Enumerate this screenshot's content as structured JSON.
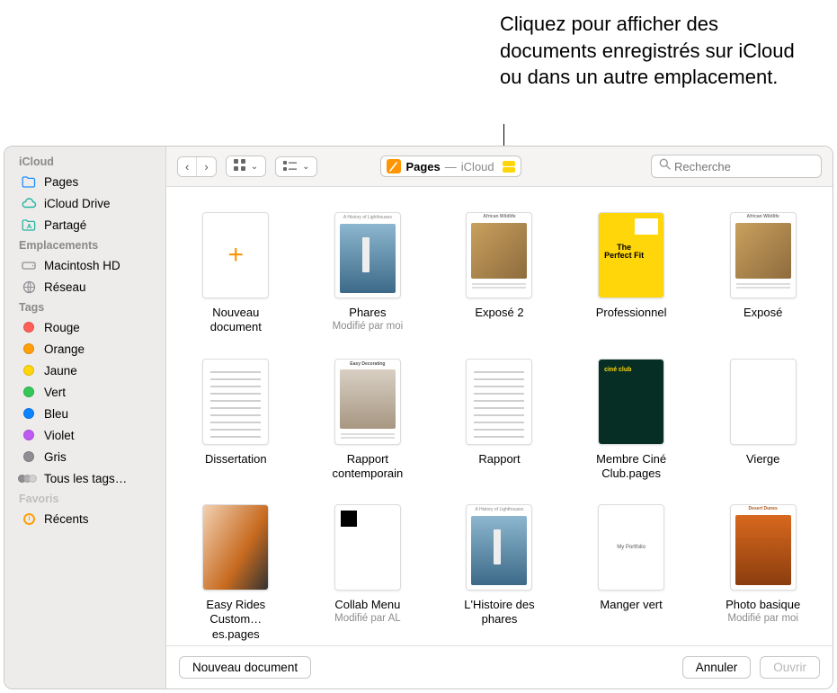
{
  "callout": "Cliquez pour afficher des documents enregistrés sur iCloud ou dans un autre emplacement.",
  "sidebar": {
    "sections": {
      "icloud": {
        "header": "iCloud",
        "items": [
          {
            "label": "Pages"
          },
          {
            "label": "iCloud Drive"
          },
          {
            "label": "Partagé"
          }
        ]
      },
      "emplacements": {
        "header": "Emplacements",
        "items": [
          {
            "label": "Macintosh HD"
          },
          {
            "label": "Réseau"
          }
        ]
      },
      "tags": {
        "header": "Tags",
        "items": [
          {
            "label": "Rouge"
          },
          {
            "label": "Orange"
          },
          {
            "label": "Jaune"
          },
          {
            "label": "Vert"
          },
          {
            "label": "Bleu"
          },
          {
            "label": "Violet"
          },
          {
            "label": "Gris"
          },
          {
            "label": "Tous les tags…"
          }
        ]
      },
      "favoris": {
        "header": "Favoris",
        "items": [
          {
            "label": "Récents"
          }
        ]
      }
    }
  },
  "toolbar": {
    "location_app": "Pages",
    "location_sep": "—",
    "location_store": "iCloud",
    "search_placeholder": "Recherche"
  },
  "grid": {
    "rows": [
      [
        {
          "title": "Nouveau document",
          "sub": "",
          "kind": "new"
        },
        {
          "title": "Phares",
          "sub": "Modifié par moi",
          "kind": "lighthouse"
        },
        {
          "title": "Exposé 2",
          "sub": "",
          "kind": "wildlife"
        },
        {
          "title": "Professionnel",
          "sub": "",
          "kind": "perfectfit"
        },
        {
          "title": "Exposé",
          "sub": "",
          "kind": "wildlife"
        }
      ],
      [
        {
          "title": "Dissertation",
          "sub": "",
          "kind": "textdoc"
        },
        {
          "title": "Rapport contemporain",
          "sub": "",
          "kind": "decor"
        },
        {
          "title": "Rapport",
          "sub": "",
          "kind": "textdoc"
        },
        {
          "title": "Membre Ciné Club.pages",
          "sub": "",
          "kind": "cineclub"
        },
        {
          "title": "Vierge",
          "sub": "",
          "kind": "blank"
        }
      ],
      [
        {
          "title": "Easy Rides Custom…es.pages",
          "sub": "",
          "kind": "bike"
        },
        {
          "title": "Collab Menu",
          "sub": "Modifié par AL",
          "kind": "collab"
        },
        {
          "title": "L'Histoire des phares",
          "sub": "",
          "kind": "lighthouse"
        },
        {
          "title": "Manger vert",
          "sub": "",
          "kind": "portfolio"
        },
        {
          "title": "Photo basique",
          "sub": "Modifié par moi",
          "kind": "desert"
        }
      ]
    ]
  },
  "footer": {
    "new_doc": "Nouveau document",
    "cancel": "Annuler",
    "open": "Ouvrir"
  }
}
